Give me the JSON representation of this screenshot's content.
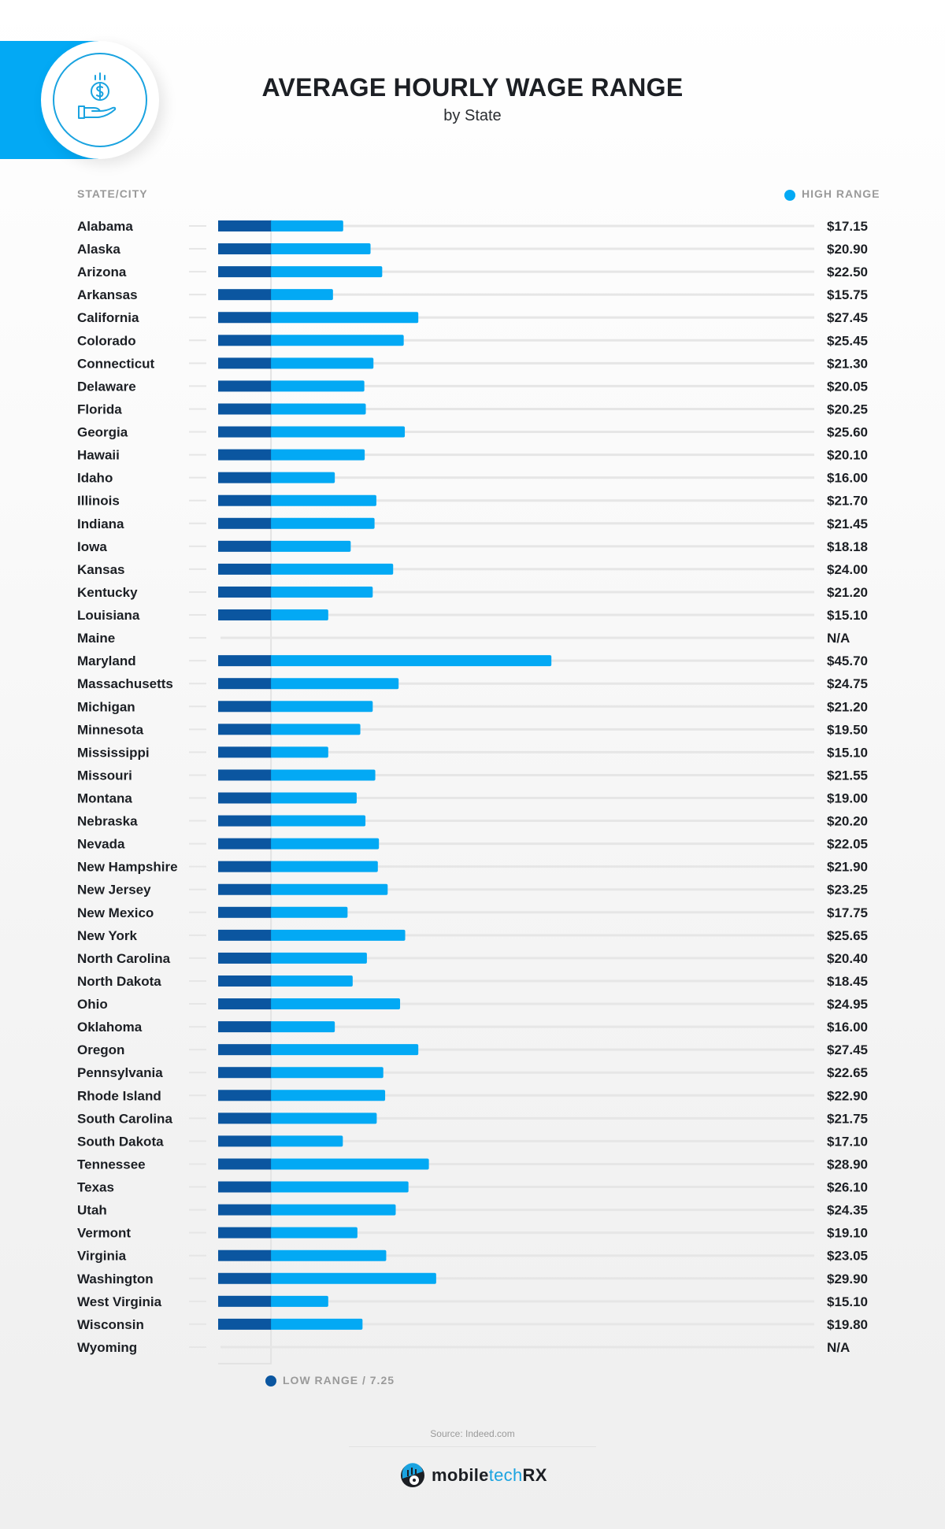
{
  "header": {
    "title": "AVERAGE HOURLY WAGE RANGE",
    "subtitle": "by State",
    "icon": "money-hand-icon"
  },
  "colors": {
    "low_range": "#0b56a0",
    "high_range": "#03a9f4",
    "accent_strip": "#03a9f4",
    "gridline": "#e6e6e6"
  },
  "column_headers": {
    "left": "STATE/CITY",
    "right": "HIGH RANGE"
  },
  "chart_data": {
    "type": "bar",
    "orientation": "horizontal",
    "title": "AVERAGE HOURLY WAGE RANGE",
    "subtitle": "by State",
    "xlabel": "",
    "ylabel": "STATE/CITY",
    "legend": [
      {
        "name": "HIGH RANGE",
        "color": "#03a9f4",
        "placement": "top-right"
      },
      {
        "name": "LOW RANGE / 7.25",
        "color": "#0b56a0",
        "placement": "bottom"
      }
    ],
    "low_range": 7.25,
    "grid": true,
    "xlim": [
      0,
      82
    ],
    "categories": [
      "Alabama",
      "Alaska",
      "Arizona",
      "Arkansas",
      "California",
      "Colorado",
      "Connecticut",
      "Delaware",
      "Florida",
      "Georgia",
      "Hawaii",
      "Idaho",
      "Illinois",
      "Indiana",
      "Iowa",
      "Kansas",
      "Kentucky",
      "Louisiana",
      "Maine",
      "Maryland",
      "Massachusetts",
      "Michigan",
      "Minnesota",
      "Mississippi",
      "Missouri",
      "Montana",
      "Nebraska",
      "Nevada",
      "New Hampshire",
      "New Jersey",
      "New Mexico",
      "New York",
      "North Carolina",
      "North Dakota",
      "Ohio",
      "Oklahoma",
      "Oregon",
      "Pennsylvania",
      "Rhode Island",
      "South Carolina",
      "South Dakota",
      "Tennessee",
      "Texas",
      "Utah",
      "Vermont",
      "Virginia",
      "Washington",
      "West Virginia",
      "Wisconsin",
      "Wyoming"
    ],
    "series": [
      {
        "name": "LOW RANGE",
        "values": [
          7.25,
          7.25,
          7.25,
          7.25,
          7.25,
          7.25,
          7.25,
          7.25,
          7.25,
          7.25,
          7.25,
          7.25,
          7.25,
          7.25,
          7.25,
          7.25,
          7.25,
          7.25,
          null,
          7.25,
          7.25,
          7.25,
          7.25,
          7.25,
          7.25,
          7.25,
          7.25,
          7.25,
          7.25,
          7.25,
          7.25,
          7.25,
          7.25,
          7.25,
          7.25,
          7.25,
          7.25,
          7.25,
          7.25,
          7.25,
          7.25,
          7.25,
          7.25,
          7.25,
          7.25,
          7.25,
          7.25,
          7.25,
          7.25,
          null
        ]
      },
      {
        "name": "HIGH RANGE",
        "values": [
          17.15,
          20.9,
          22.5,
          15.75,
          27.45,
          25.45,
          21.3,
          20.05,
          20.25,
          25.6,
          20.1,
          16.0,
          21.7,
          21.45,
          18.18,
          24.0,
          21.2,
          15.1,
          null,
          45.7,
          24.75,
          21.2,
          19.5,
          15.1,
          21.55,
          19.0,
          20.2,
          22.05,
          21.9,
          23.25,
          17.75,
          25.65,
          20.4,
          18.45,
          24.95,
          16.0,
          27.45,
          22.65,
          22.9,
          21.75,
          17.1,
          28.9,
          26.1,
          24.35,
          19.1,
          23.05,
          29.9,
          15.1,
          19.8,
          null
        ]
      }
    ],
    "value_labels": [
      "$17.15",
      "$20.90",
      "$22.50",
      "$15.75",
      "$27.45",
      "$25.45",
      "$21.30",
      "$20.05",
      "$20.25",
      "$25.60",
      "$20.10",
      "$16.00",
      "$21.70",
      "$21.45",
      "$18.18",
      "$24.00",
      "$21.20",
      "$15.10",
      "N/A",
      "$45.70",
      "$24.75",
      "$21.20",
      "$19.50",
      "$15.10",
      "$21.55",
      "$19.00",
      "$20.20",
      "$22.05",
      "$21.90",
      "$23.25",
      "$17.75",
      "$25.65",
      "$20.40",
      "$18.45",
      "$24.95",
      "$16.00",
      "$27.45",
      "$22.65",
      "$22.90",
      "$21.75",
      "$17.10",
      "$28.90",
      "$26.10",
      "$24.35",
      "$19.10",
      "$23.05",
      "$29.90",
      "$15.10",
      "$19.80",
      "N/A"
    ]
  },
  "footer": {
    "low_legend": "LOW RANGE / 7.25",
    "source": "Source: Indeed.com",
    "logo": {
      "part1": "mobile",
      "part2": "tech",
      "part3": "RX",
      "icon": "mobiletechrx-logo-icon"
    }
  }
}
